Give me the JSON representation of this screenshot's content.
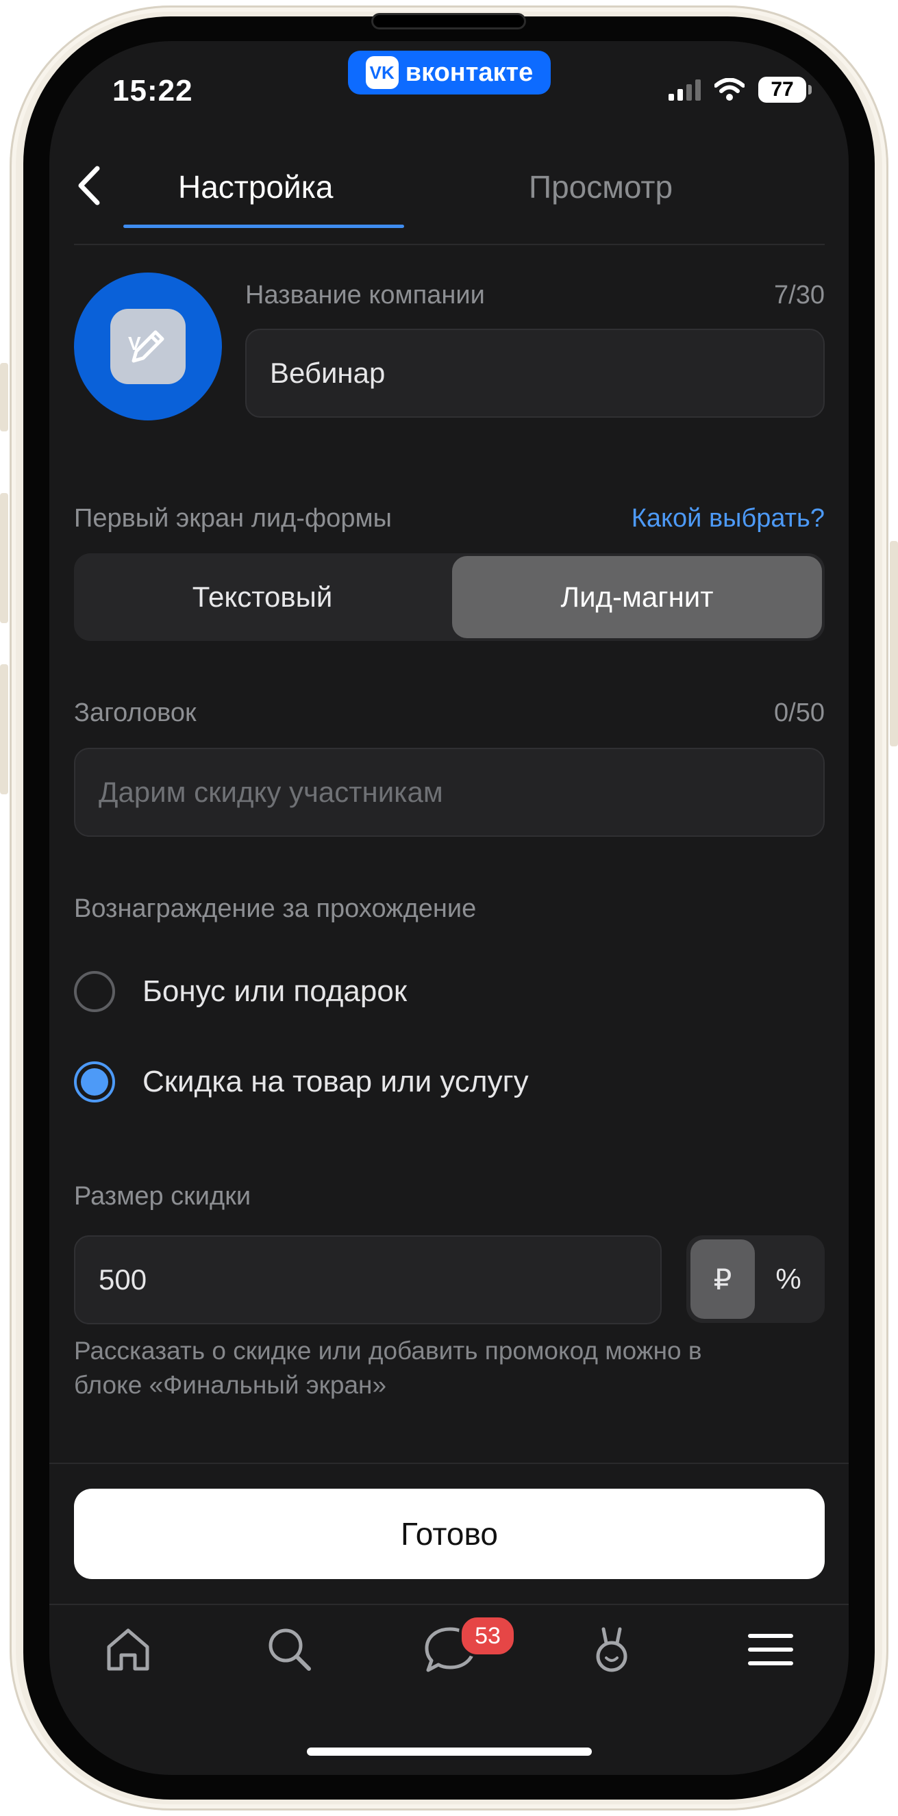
{
  "status_bar": {
    "time": "15:22",
    "app_pill": "вконтакте",
    "app_logo": "VK",
    "battery": "77"
  },
  "header": {
    "tabs": [
      {
        "label": "Настройка",
        "active": true
      },
      {
        "label": "Просмотр",
        "active": false
      }
    ]
  },
  "company": {
    "label": "Название компании",
    "counter": "7/30",
    "value": "Вебинар"
  },
  "first_screen": {
    "label": "Первый экран лид-формы",
    "help_link": "Какой выбрать?",
    "options": [
      {
        "label": "Текстовый",
        "selected": false
      },
      {
        "label": "Лид-магнит",
        "selected": true
      }
    ]
  },
  "headline": {
    "label": "Заголовок",
    "counter": "0/50",
    "placeholder": "Дарим скидку участникам"
  },
  "reward": {
    "label": "Вознаграждение за прохождение",
    "options": [
      {
        "label": "Бонус или подарок",
        "selected": false
      },
      {
        "label": "Скидка на товар или услугу",
        "selected": true
      }
    ]
  },
  "discount": {
    "label": "Размер скидки",
    "value": "500",
    "units": [
      {
        "label": "₽",
        "selected": true
      },
      {
        "label": "%",
        "selected": false
      }
    ],
    "hint": "Рассказать о скидке или добавить промокод можно в блоке «Финальный экран»"
  },
  "done_button": "Готово",
  "tabbar": {
    "items": [
      "home-icon",
      "search-icon",
      "messages-icon",
      "clips-icon",
      "menu-icon"
    ],
    "messages_badge": "53"
  },
  "colors": {
    "background": "#19191a",
    "accent": "#4d9af7",
    "vk_blue": "#0d6bff",
    "badge": "#e64646"
  }
}
